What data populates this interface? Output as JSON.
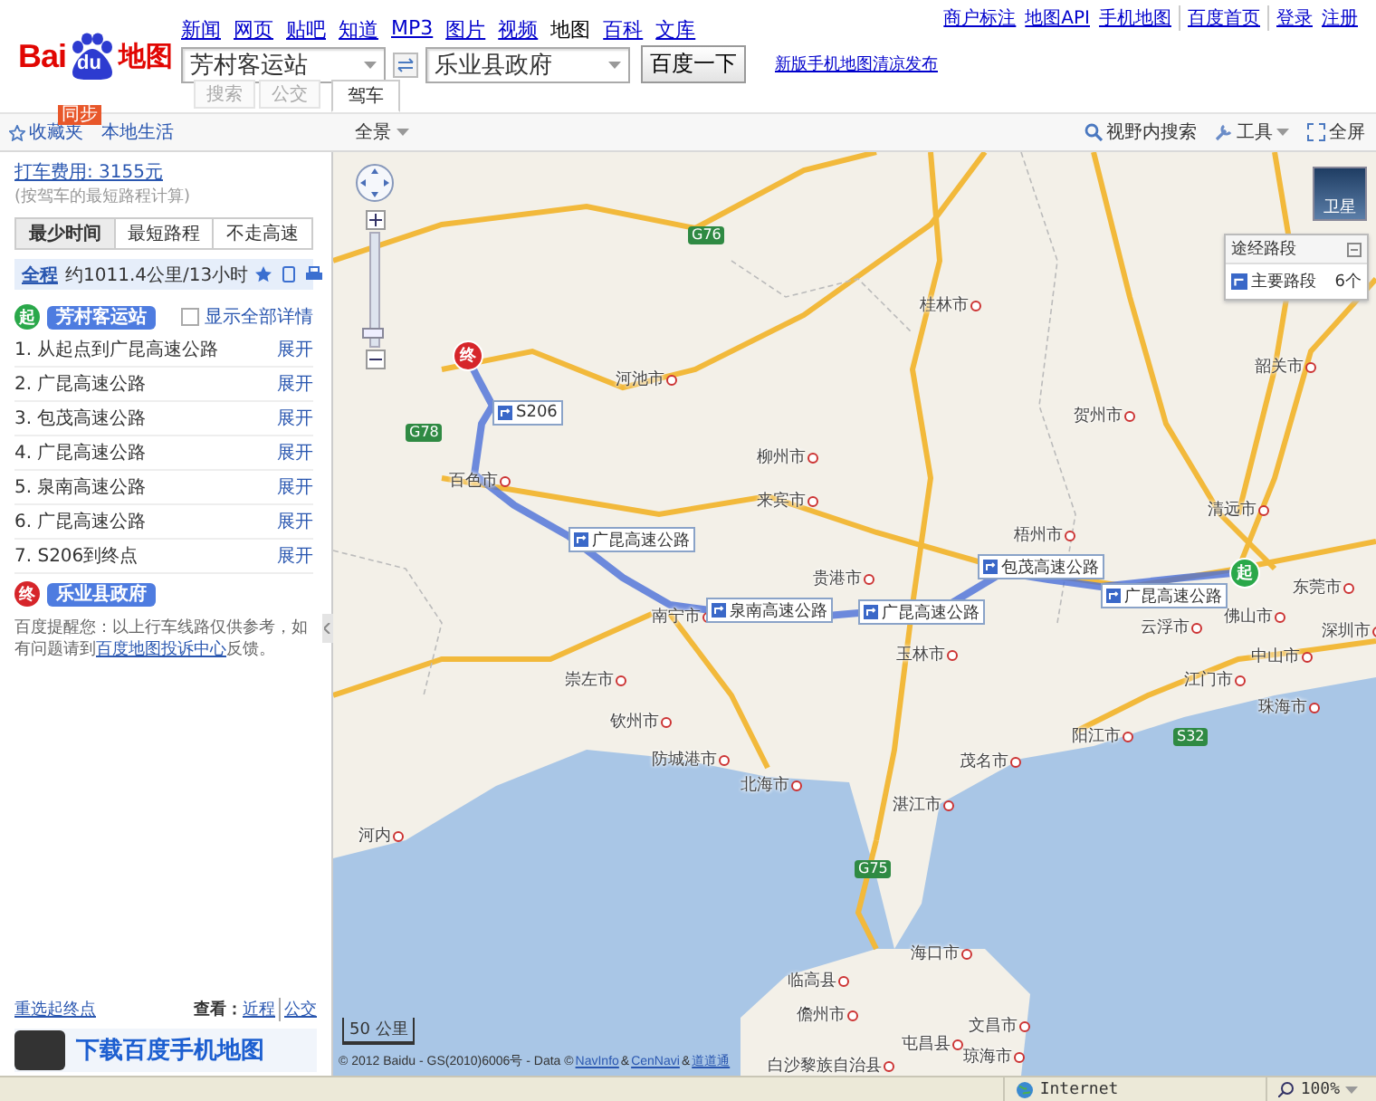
{
  "header": {
    "logo": {
      "brand": "Bai",
      "paw": "du",
      "product": "地图"
    },
    "nav_links": [
      {
        "label": "新闻",
        "selected": false
      },
      {
        "label": "网页",
        "selected": false
      },
      {
        "label": "贴吧",
        "selected": false
      },
      {
        "label": "知道",
        "selected": false
      },
      {
        "label": "MP3",
        "selected": false
      },
      {
        "label": "图片",
        "selected": false
      },
      {
        "label": "视频",
        "selected": false
      },
      {
        "label": "地图",
        "selected": true
      },
      {
        "label": "百科",
        "selected": false
      },
      {
        "label": "文库",
        "selected": false
      }
    ],
    "top_link_groups": [
      [
        "商户标注",
        "地图API",
        "手机地图"
      ],
      [
        "百度首页"
      ],
      [
        "登录",
        "注册"
      ]
    ],
    "search": {
      "from": "芳村客运站",
      "to": "乐业县政府",
      "submit": "百度一下",
      "modes": [
        {
          "label": "搜索",
          "selected": false
        },
        {
          "label": "公交",
          "selected": false
        },
        {
          "label": "驾车",
          "selected": true
        }
      ]
    },
    "promo_link": "新版手机地图清凉发布"
  },
  "toolbar": {
    "favorites": "收藏夹",
    "sync_badge": "同步",
    "local_life": "本地生活",
    "map_view": "全景",
    "tools": [
      {
        "kind": "search",
        "label": "视野内搜索"
      },
      {
        "kind": "tools",
        "label": "工具"
      },
      {
        "kind": "fullscreen",
        "label": "全屏"
      }
    ]
  },
  "route_panel": {
    "taxi_link": "打车费用: 3155元",
    "taxi_note": "(按驾车的最短路程计算)",
    "strategies": [
      {
        "label": "最少时间",
        "selected": true
      },
      {
        "label": "最短路程",
        "selected": false
      },
      {
        "label": "不走高速",
        "selected": false
      }
    ],
    "summary": {
      "label": "全程",
      "text": "约1011.4公里/13小时"
    },
    "start": {
      "marker": "起",
      "name": "芳村客运站"
    },
    "show_all": {
      "label": "显示全部详情",
      "checked": false
    },
    "steps": [
      {
        "text": "1. 从起点到广昆高速公路",
        "action": "展开"
      },
      {
        "text": "2. 广昆高速公路",
        "action": "展开"
      },
      {
        "text": "3. 包茂高速公路",
        "action": "展开"
      },
      {
        "text": "4. 广昆高速公路",
        "action": "展开"
      },
      {
        "text": "5. 泉南高速公路",
        "action": "展开"
      },
      {
        "text": "6. 广昆高速公路",
        "action": "展开"
      },
      {
        "text": "7. S206到终点",
        "action": "展开"
      }
    ],
    "end": {
      "marker": "终",
      "name": "乐业县政府"
    },
    "notice": [
      {
        "kind": "text",
        "text": "百度提醒您：以上行车线路仅供参考，如有问题请到"
      },
      {
        "kind": "link",
        "text": "百度地图投诉中心"
      },
      {
        "kind": "text",
        "text": "反馈。"
      }
    ],
    "reselect": "重选起终点",
    "view_label": "查看：",
    "view_links": [
      "近程",
      "公交"
    ],
    "banner": "下载百度手机地图"
  },
  "map": {
    "satellite": "卫星",
    "zoom": {
      "level": 0.08
    },
    "via_panel": {
      "title": "途经路段",
      "item": "主要路段",
      "count": "6个"
    },
    "start_marker": "起",
    "end_marker": "终",
    "route_labels": [
      "S206",
      "广昆高速公路",
      "泉南高速公路",
      "广昆高速公路",
      "包茂高速公路",
      "广昆高速公路"
    ],
    "road_shields": [
      "G76",
      "G78",
      "G75",
      "S32"
    ],
    "cities": [
      "桂林市",
      "河池市",
      "韶关市",
      "贺州市",
      "柳州市",
      "百色市",
      "来宾市",
      "清远市",
      "梧州市",
      "贵港市",
      "东莞市",
      "南宁市",
      "云浮市",
      "佛山市",
      "深圳市",
      "玉林市",
      "中山市",
      "崇左市",
      "江门市",
      "珠海市",
      "钦州市",
      "阳江市",
      "防城港市",
      "茂名市",
      "北海市",
      "湛江市",
      "河内",
      "海口市",
      "临高县",
      "儋州市",
      "文昌市",
      "白沙黎族自治县",
      "屯昌县",
      "琼海市"
    ],
    "scale": "50 公里",
    "copyright": [
      {
        "kind": "text",
        "text": "© 2012 Baidu - GS(2010)6006号 - Data ©"
      },
      {
        "kind": "link",
        "text": "NavInfo"
      },
      {
        "kind": "text",
        "text": "&"
      },
      {
        "kind": "link",
        "text": "CenNavi"
      },
      {
        "kind": "text",
        "text": "&"
      },
      {
        "kind": "link",
        "text": "道道通"
      }
    ]
  },
  "status_bar": {
    "zone": "Internet",
    "zoom": "100%"
  }
}
